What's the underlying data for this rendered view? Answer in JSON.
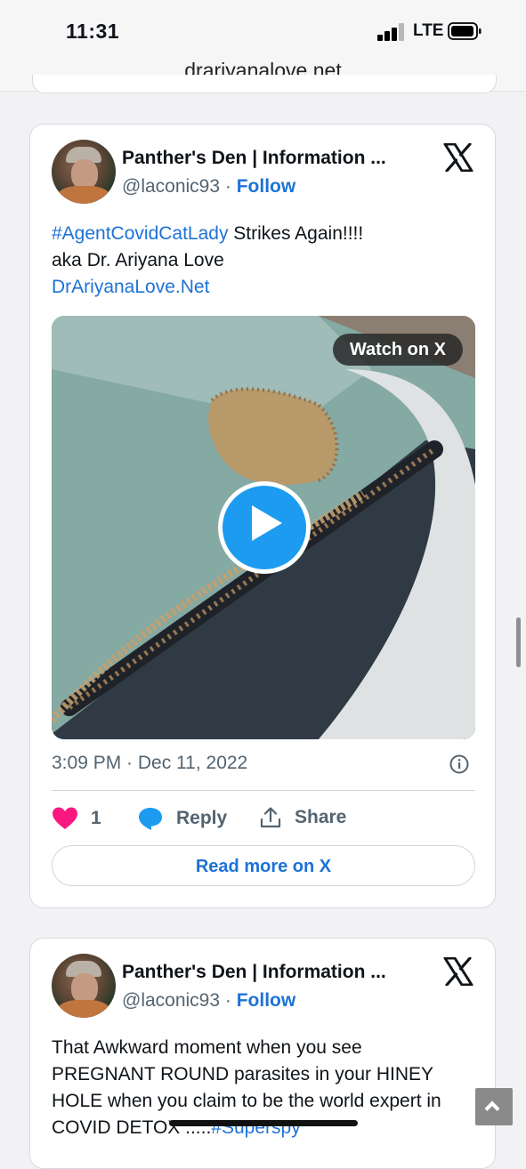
{
  "status_bar": {
    "time": "11:31",
    "network": "LTE"
  },
  "browser": {
    "url": "drariyanalove.net"
  },
  "tweets": [
    {
      "author_name": "Panther's Den | Information ...",
      "handle": "@laconic93",
      "separator": " · ",
      "follow_label": "Follow",
      "text_hashtag": "#AgentCovidCatLady",
      "text_line1_rest": " Strikes Again!!!!",
      "text_line2": "aka Dr. Ariyana Love",
      "text_link": "DrAriyanaLove.Net",
      "video_button": "Watch on X",
      "timestamp": "3:09 PM · Dec 11, 2022",
      "likes": "1",
      "reply_label": "Reply",
      "share_label": "Share",
      "read_more": "Read more on X"
    },
    {
      "author_name": "Panther's Den | Information ...",
      "handle": "@laconic93",
      "separator": " · ",
      "follow_label": "Follow",
      "text_line1": "That Awkward moment when you see",
      "text_line2": "PREGNANT ROUND parasites in your HINEY",
      "text_line3": "HOLE when you claim to be the world expert in",
      "text_line4_prefix": "COVID DETOX .....",
      "text_line4_hashtag": "#Superspy"
    }
  ],
  "colors": {
    "link": "#1d72d6",
    "like": "#f91880",
    "play": "#1d9bf0"
  },
  "icons": [
    "signal-icon",
    "battery-icon",
    "x-logo-icon",
    "play-icon",
    "info-icon",
    "heart-icon",
    "reply-icon",
    "share-icon",
    "chevron-up-icon"
  ]
}
